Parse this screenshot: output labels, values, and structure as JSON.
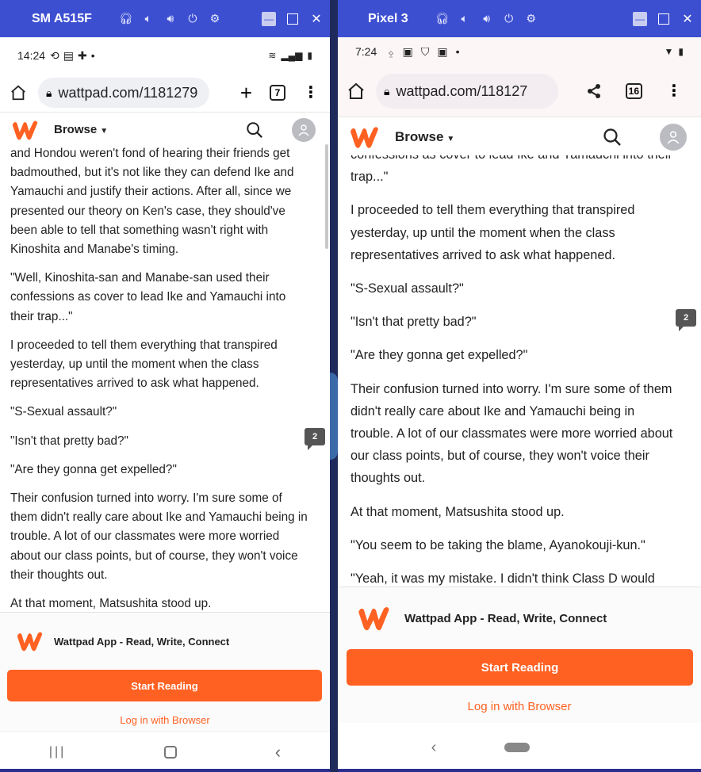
{
  "left_device": {
    "title": "SM A515F",
    "status_time": "14:24",
    "url": "wattpad.com/1181279",
    "tab_count": "7",
    "browse_label": "Browse",
    "paragraphs": [
      "and Hondou weren't fond of hearing their friends get badmouthed, but it's not like they can defend Ike and Yamauchi and justify their actions. After all, since we presented our theory on Ken's case, they should've been able to tell that something wasn't right with Kinoshita and Manabe's timing.",
      "\"Well, Kinoshita-san and Manabe-san used their confessions as cover to lead Ike and Yamauchi into their trap...\"",
      "I proceeded to tell them everything that transpired yesterday, up until the moment when the class representatives arrived to ask what happened.",
      "\"S-Sexual assault?\"",
      "\"Isn't that pretty bad?\"",
      "\"Are they gonna get expelled?\"",
      "Their confusion turned into worry. I'm sure some of them didn't really care about Ike and Yamauchi being in trouble. A lot of our classmates were more worried about our class points, but of course, they won't voice their thoughts out.",
      "At that moment, Matsushita stood up."
    ],
    "comment_count": "2",
    "promo_title": "Wattpad App - Read, Write, Connect",
    "start_button": "Start Reading",
    "login_link": "Log in with Browser"
  },
  "right_device": {
    "title": "Pixel 3",
    "status_time": "7:24",
    "url": "wattpad.com/118127",
    "tab_count": "16",
    "browse_label": "Browse",
    "clipped_line": "confessions as cover to lead Ike and Yamauchi into their",
    "paragraphs": [
      "trap...\"",
      "I proceeded to tell them everything that transpired yesterday, up until the moment when the class representatives arrived to ask what happened.",
      "\"S-Sexual assault?\"",
      "\"Isn't that pretty bad?\"",
      "\"Are they gonna get expelled?\"",
      "Their confusion turned into worry. I'm sure some of them didn't really care about Ike and Yamauchi being in trouble. A lot of our classmates were more worried about our class points, but of course, they won't voice their thoughts out.",
      "At that moment, Matsushita stood up.",
      "\"You seem to be taking the blame, Ayanokouji-kun.\"",
      "\"Yeah, it was my mistake. I didn't think Class D would"
    ],
    "comment_count": "2",
    "promo_title": "Wattpad App - Read, Write, Connect",
    "start_button": "Start Reading",
    "login_link": "Log in with Browser"
  },
  "colors": {
    "titlebar": "#3d4fd1",
    "wattpad_orange": "#ff6122",
    "background": "#2a2f8f"
  }
}
